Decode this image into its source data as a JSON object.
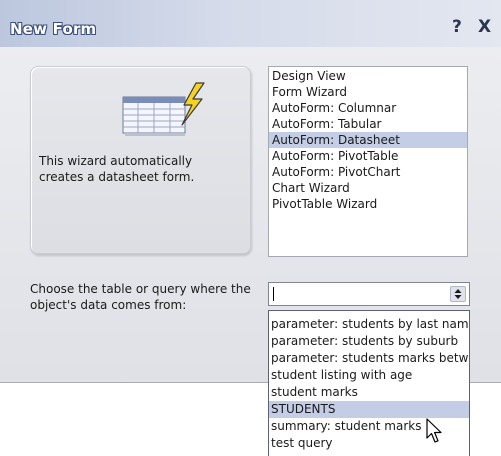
{
  "window": {
    "title": "New Form",
    "help_label": "?",
    "close_label": "X"
  },
  "preview": {
    "icon": "datasheet-wizard-icon",
    "description": "This wizard automatically creates a datasheet form."
  },
  "form_types": {
    "items": [
      {
        "label": "Design View"
      },
      {
        "label": "Form Wizard"
      },
      {
        "label": "AutoForm:  Columnar"
      },
      {
        "label": "AutoForm:  Tabular"
      },
      {
        "label": "AutoForm:  Datasheet"
      },
      {
        "label": "AutoForm:  PivotTable"
      },
      {
        "label": "AutoForm:  PivotChart"
      },
      {
        "label": "Chart Wizard"
      },
      {
        "label": "PivotTable Wizard"
      }
    ],
    "selected_index": 4
  },
  "source": {
    "label": "Choose the table or query where the object's data comes from:",
    "combo_value": "",
    "dropdown_items": [
      {
        "label": "parameter: students by last name"
      },
      {
        "label": "parameter: students by suburb"
      },
      {
        "label": "parameter: students marks between"
      },
      {
        "label": "student listing with age"
      },
      {
        "label": "student marks"
      },
      {
        "label": "STUDENTS"
      },
      {
        "label": "summary: student marks"
      },
      {
        "label": "test query"
      }
    ],
    "selected_index": 5
  },
  "colors": {
    "selection": "#c4cde6",
    "titlebar_text": "#ffffff",
    "dialog_body": "#e5e7eb"
  }
}
